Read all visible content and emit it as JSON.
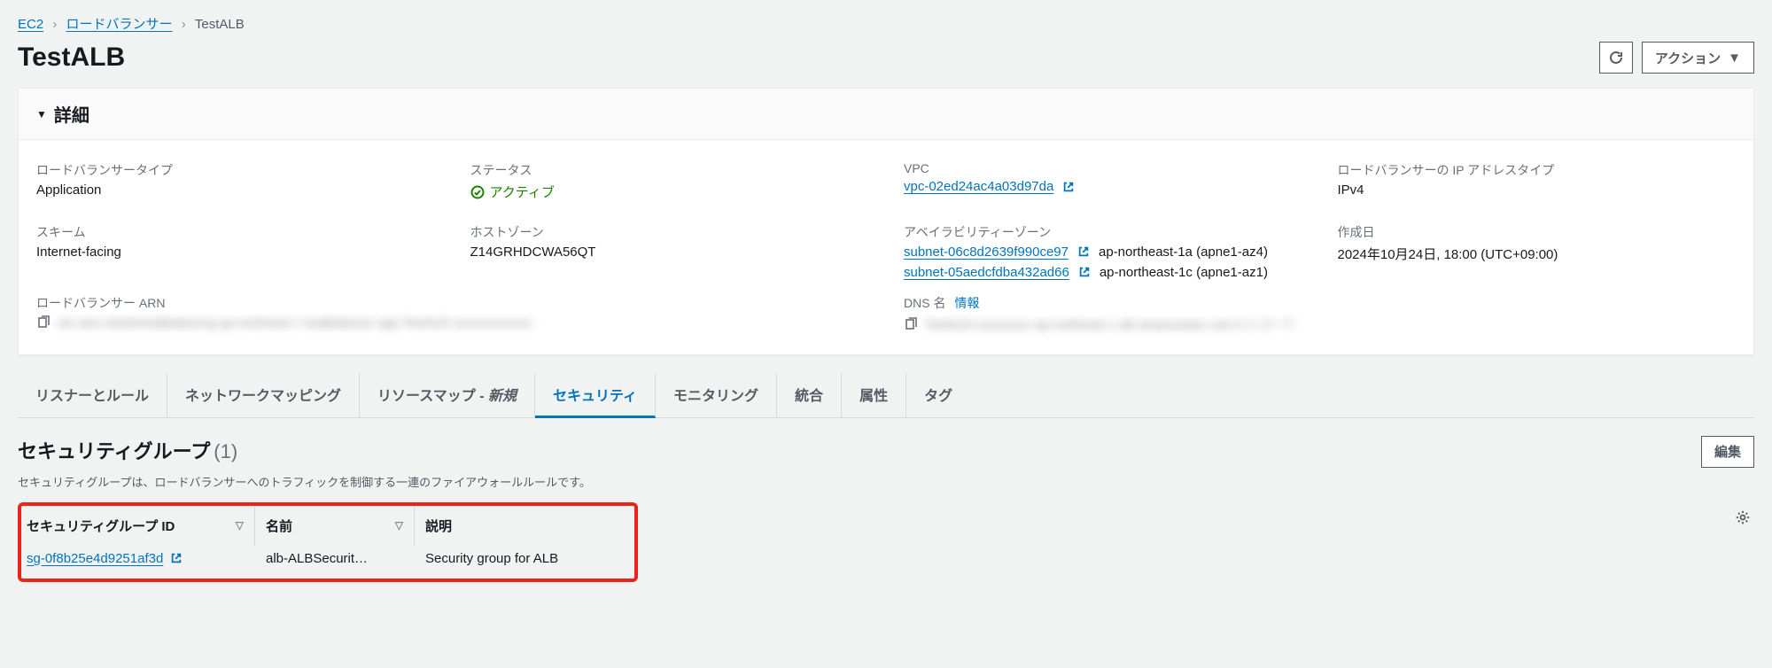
{
  "breadcrumb": {
    "ec2": "EC2",
    "lb": "ロードバランサー",
    "current": "TestALB"
  },
  "header": {
    "title": "TestALB",
    "actions_label": "アクション"
  },
  "details": {
    "panel_title": "詳細",
    "type_label": "ロードバランサータイプ",
    "type_value": "Application",
    "status_label": "ステータス",
    "status_value": "アクティブ",
    "vpc_label": "VPC",
    "vpc_value": "vpc-02ed24ac4a03d97da",
    "ip_type_label": "ロードバランサーの IP アドレスタイプ",
    "ip_type_value": "IPv4",
    "scheme_label": "スキーム",
    "scheme_value": "Internet-facing",
    "hosted_zone_label": "ホストゾーン",
    "hosted_zone_value": "Z14GRHDCWA56QT",
    "az_label": "アベイラビリティーゾーン",
    "subnet1_link": "subnet-06c8d2639f990ce97",
    "subnet1_az": "ap-northeast-1a (apne1-az4)",
    "subnet2_link": "subnet-05aedcfdba432ad66",
    "subnet2_az": "ap-northeast-1c (apne1-az1)",
    "created_label": "作成日",
    "created_value": "2024年10月24日, 18:00 (UTC+09:00)",
    "arn_label": "ロードバランサー ARN",
    "arn_value": "arn aws elasticloadbalancing ap-northeast-1  loadbalancer app TestALB xxxxxxxxxxxxx",
    "dns_label": "DNS 名",
    "dns_info": "情報",
    "dns_value": "TestALB-xxxxxxxxx ap-northeast-1 elb amazonaws com  A レコード"
  },
  "tabs": {
    "t0": "リスナーとルール",
    "t1": "ネットワークマッピング",
    "t2_a": "リソースマップ - ",
    "t2_b": "新規",
    "t3": "セキュリティ",
    "t4": "モニタリング",
    "t5": "統合",
    "t6": "属性",
    "t7": "タグ"
  },
  "sg": {
    "title": "セキュリティグループ",
    "count": "(1)",
    "desc": "セキュリティグループは、ロードバランサーへのトラフィックを制御する一連のファイアウォールルールです。",
    "edit": "編集",
    "col_id": "セキュリティグループ ID",
    "col_name": "名前",
    "col_desc": "説明",
    "row_id": "sg-0f8b25e4d9251af3d",
    "row_name": "alb-ALBSecurit…",
    "row_desc": "Security group for ALB"
  }
}
